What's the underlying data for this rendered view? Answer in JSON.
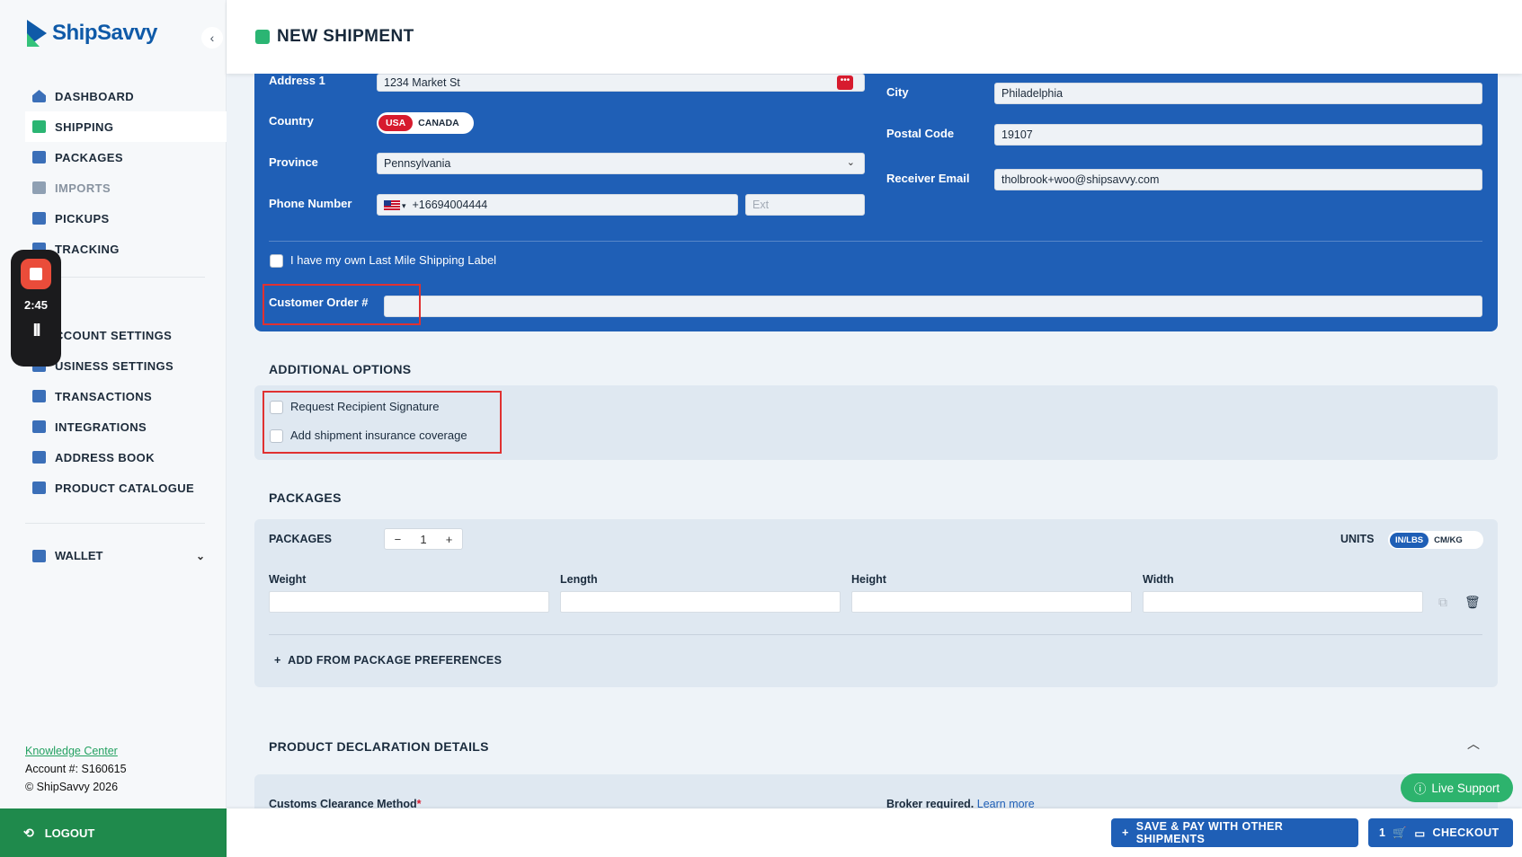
{
  "sidebar": {
    "logo_prefix": "Ship",
    "logo_suffix": "Savvy",
    "collapse_icon": "‹",
    "items": [
      {
        "label": "DASHBOARD",
        "icon": "home-icon",
        "color": "#3b6fb8"
      },
      {
        "label": "SHIPPING",
        "icon": "shipping-box-icon",
        "color": "#2bb573"
      },
      {
        "label": "PACKAGES",
        "icon": "packages-icon",
        "color": "#3b6fb8"
      },
      {
        "label": "IMPORTS",
        "icon": "imports-icon",
        "color": "#8fa0b3"
      },
      {
        "label": "PICKUPS",
        "icon": "pickups-icon",
        "color": "#3b6fb8"
      },
      {
        "label": "TRACKING",
        "icon": "tracking-icon",
        "color": "#3b6fb8"
      }
    ],
    "items2": [
      {
        "label": "CCOUNT SETTINGS",
        "icon": "account-settings-icon",
        "color": "#3b6fb8"
      },
      {
        "label": "USINESS SETTINGS",
        "icon": "business-settings-icon",
        "color": "#3b6fb8"
      },
      {
        "label": "TRANSACTIONS",
        "icon": "transactions-icon",
        "color": "#3b6fb8"
      },
      {
        "label": "INTEGRATIONS",
        "icon": "integrations-icon",
        "color": "#3b6fb8"
      },
      {
        "label": "ADDRESS BOOK",
        "icon": "address-book-icon",
        "color": "#3b6fb8"
      },
      {
        "label": "PRODUCT CATALOGUE",
        "icon": "product-catalogue-icon",
        "color": "#3b6fb8"
      }
    ],
    "wallet_label": "WALLET",
    "knowledge_center": "Knowledge Center",
    "account": "Account #: S160615",
    "copyright": "© ShipSavvy 2026",
    "logout": "LOGOUT"
  },
  "recorder": {
    "time": "2:45",
    "pause_glyph": "II"
  },
  "header": {
    "title": "NEW SHIPMENT"
  },
  "form": {
    "address1_label": "Address 1",
    "address1_value": "1234 Market St",
    "country_label": "Country",
    "country_options": [
      "USA",
      "CANADA"
    ],
    "province_label": "Province",
    "province_value": "Pennsylvania",
    "phone_label": "Phone Number",
    "phone_value": "+16694004444",
    "ext_placeholder": "Ext",
    "city_label": "City",
    "city_value": "Philadelphia",
    "postal_label": "Postal Code",
    "postal_value": "19107",
    "email_label": "Receiver Email",
    "email_value": "tholbrook+woo@shipsavvy.com",
    "last_mile_label": "I have my own Last Mile Shipping Label",
    "customer_order_label": "Customer Order #",
    "customer_order_value": ""
  },
  "additional_options": {
    "title": "ADDITIONAL OPTIONS",
    "signature_label": "Request Recipient Signature",
    "insurance_label": "Add shipment insurance coverage"
  },
  "packages": {
    "section_title": "PACKAGES",
    "label": "PACKAGES",
    "count": "1",
    "minus": "−",
    "plus": "+",
    "units_label": "UNITS",
    "units_options": [
      "IN/LBS",
      "CM/KG"
    ],
    "dims": [
      "Weight",
      "Length",
      "Height",
      "Width"
    ],
    "add_pref": "ADD FROM PACKAGE PREFERENCES"
  },
  "declaration": {
    "title": "PRODUCT DECLARATION DETAILS",
    "customs_label": "Customs Clearance Method",
    "broker_text": "Broker required.",
    "learn_more": "Learn more"
  },
  "bottom": {
    "save_pay": "SAVE & PAY WITH OTHER SHIPMENTS",
    "cart_count": "1",
    "checkout": "CHECKOUT",
    "live_support": "Live Support"
  }
}
